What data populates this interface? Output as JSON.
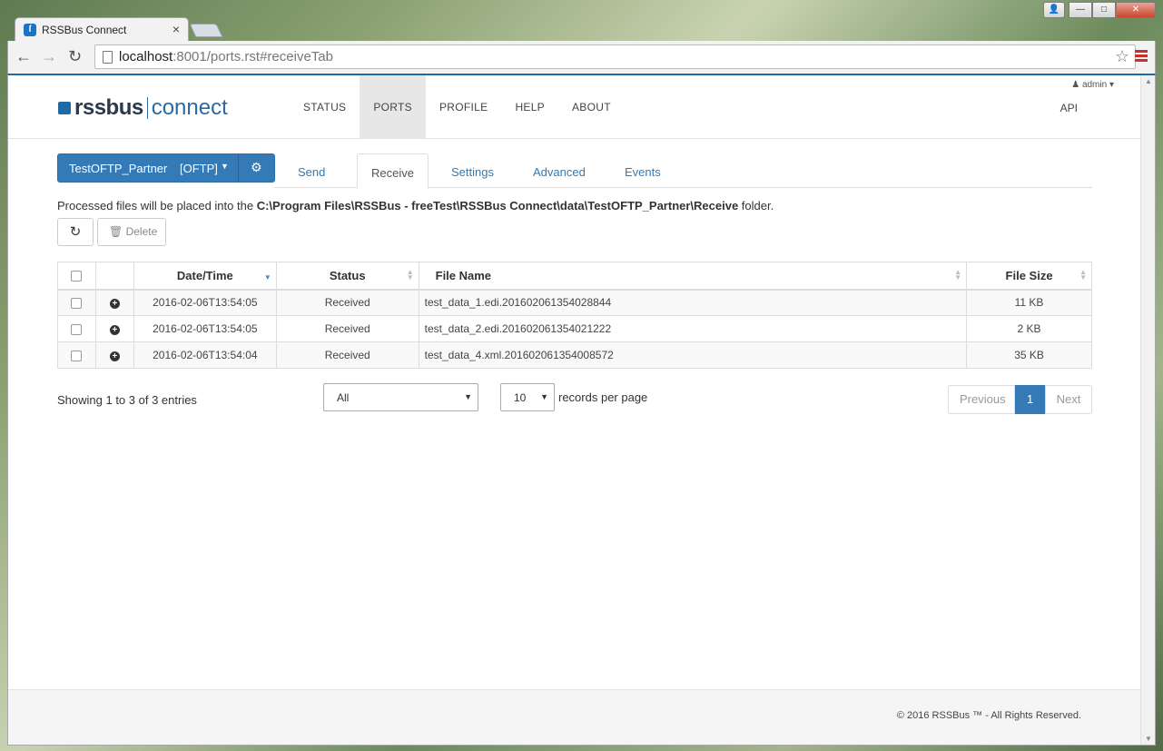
{
  "browser": {
    "tab_title": "RSSBus Connect",
    "tab_close": "×",
    "url_host": "localhost",
    "url_path": ":8001/ports.rst#receiveTab",
    "window_buttons": {
      "user": "👤",
      "minimize": "—",
      "maximize": "□",
      "close": "✕"
    }
  },
  "header": {
    "logo_rss": "rssbus",
    "logo_connect": "connect",
    "nav": [
      "STATUS",
      "PORTS",
      "PROFILE",
      "HELP",
      "ABOUT"
    ],
    "active_nav": "PORTS",
    "user": "admin",
    "api": "API"
  },
  "port": {
    "name": "TestOFTP_Partner",
    "protocol": "[OFTP]"
  },
  "tabs": [
    "Send",
    "Receive",
    "Settings",
    "Advanced",
    "Events"
  ],
  "active_tab": "Receive",
  "info": {
    "prefix": "Processed files will be placed into the ",
    "path": "C:\\Program Files\\RSSBus - freeTest\\RSSBus Connect\\data\\TestOFTP_Partner\\Receive",
    "suffix": " folder."
  },
  "actions": {
    "delete": "Delete"
  },
  "table": {
    "columns": {
      "date": "Date/Time",
      "status": "Status",
      "name": "File Name",
      "size": "File Size"
    },
    "rows": [
      {
        "date": "2016-02-06T13:54:05",
        "status": "Received",
        "name": "test_data_1.edi.201602061354028844",
        "size": "11 KB"
      },
      {
        "date": "2016-02-06T13:54:05",
        "status": "Received",
        "name": "test_data_2.edi.201602061354021222",
        "size": "2 KB"
      },
      {
        "date": "2016-02-06T13:54:04",
        "status": "Received",
        "name": "test_data_4.xml.201602061354008572",
        "size": "35 KB"
      }
    ]
  },
  "pagination": {
    "showing": "Showing 1 to 3 of 3 entries",
    "filter_value": "All",
    "page_size": "10",
    "records_label": "records per page",
    "previous": "Previous",
    "current": "1",
    "next": "Next"
  },
  "footer": {
    "copyright": "© 2016 RSSBus ™ - All Rights Reserved."
  },
  "colors": {
    "primary": "#337ab7",
    "status_ok": "#3c763d"
  }
}
